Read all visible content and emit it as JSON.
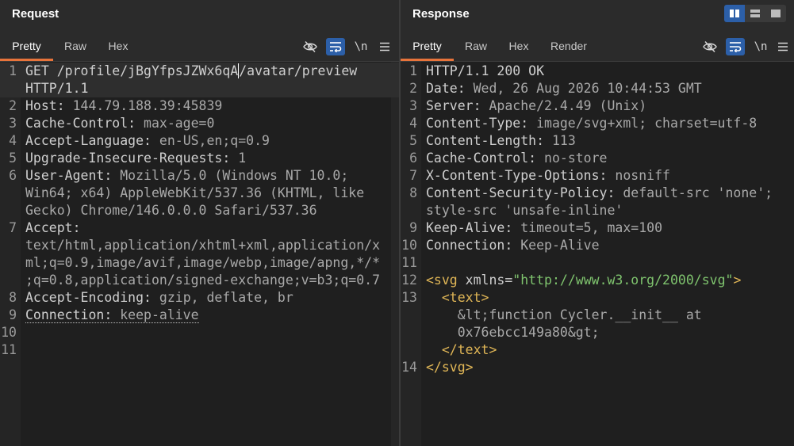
{
  "request": {
    "title": "Request",
    "tabs": [
      "Pretty",
      "Raw",
      "Hex"
    ],
    "active_tab": "Pretty",
    "lines": [
      {
        "n": "1",
        "rows": [
          [
            "GET /profile/jBgYfpsJZWx6qA",
            "/avatar/preview"
          ],
          [
            "HTTP/1.1"
          ]
        ]
      },
      {
        "n": "2",
        "key": "Host:",
        "val": " 144.79.188.39:45839"
      },
      {
        "n": "3",
        "key": "Cache-Control:",
        "val": " max-age=0"
      },
      {
        "n": "4",
        "key": "Accept-Language:",
        "val": " en-US,en;q=0.9"
      },
      {
        "n": "5",
        "key": "Upgrade-Insecure-Requests:",
        "val": " 1"
      },
      {
        "n": "6",
        "key": "User-Agent:",
        "val": " Mozilla/5.0 (Windows NT 10.0;",
        "cont": [
          "Win64; x64) AppleWebKit/537.36 (KHTML, like",
          "Gecko) Chrome/146.0.0.0 Safari/537.36"
        ]
      },
      {
        "n": "7",
        "key": "Accept:",
        "val": "",
        "cont": [
          "text/html,application/xhtml+xml,application/x",
          "ml;q=0.9,image/avif,image/webp,image/apng,*/*",
          ";q=0.8,application/signed-exchange;v=b3;q=0.7"
        ]
      },
      {
        "n": "8",
        "key": "Accept-Encoding:",
        "val": " gzip, deflate, br"
      },
      {
        "n": "9",
        "key": "Connection:",
        "val": " keep-alive"
      },
      {
        "n": "10"
      },
      {
        "n": "11"
      }
    ]
  },
  "response": {
    "title": "Response",
    "tabs": [
      "Pretty",
      "Raw",
      "Hex",
      "Render"
    ],
    "active_tab": "Pretty",
    "lines": [
      {
        "n": "1",
        "text": "HTTP/1.1 200 OK"
      },
      {
        "n": "2",
        "key": "Date:",
        "val": " Wed, 26 Aug 2026 10:44:53 GMT"
      },
      {
        "n": "3",
        "key": "Server:",
        "val": " Apache/2.4.49 (Unix)"
      },
      {
        "n": "4",
        "key": "Content-Type:",
        "val": " image/svg+xml; charset=utf-8"
      },
      {
        "n": "5",
        "key": "Content-Length:",
        "val": " 113"
      },
      {
        "n": "6",
        "key": "Cache-Control:",
        "val": " no-store"
      },
      {
        "n": "7",
        "key": "X-Content-Type-Options:",
        "val": " nosniff"
      },
      {
        "n": "8",
        "key": "Content-Security-Policy:",
        "val": " default-src 'none';",
        "cont": [
          "style-src 'unsafe-inline'"
        ]
      },
      {
        "n": "9",
        "key": "Keep-Alive:",
        "val": " timeout=5, max=100"
      },
      {
        "n": "10",
        "key": "Connection:",
        "val": " Keep-Alive"
      },
      {
        "n": "11"
      },
      {
        "n": "12",
        "svg_open": [
          "<svg",
          " xmlns",
          "=",
          "\"http://www.w3.org/2000/svg\"",
          ">"
        ]
      },
      {
        "n": "13",
        "text_open": "  <text>",
        "body": [
          "    &lt;function Cycler.__init__ at",
          "    0x76ebcc149a80&gt;"
        ],
        "text_close": "  </text>"
      },
      {
        "n": "14",
        "svg_close": "</svg>"
      }
    ]
  },
  "toolbar": {
    "newline_label": "\\n",
    "icons": [
      "eye-slash-icon",
      "word-wrap-icon",
      "newline-icon",
      "menu-icon"
    ]
  },
  "layout_buttons": [
    "split-horizontal-icon",
    "split-vertical-icon",
    "single-pane-icon"
  ],
  "colors": {
    "accent": "#e8743b",
    "selected": "#2c5fa8",
    "background": "#1f1f1f"
  }
}
